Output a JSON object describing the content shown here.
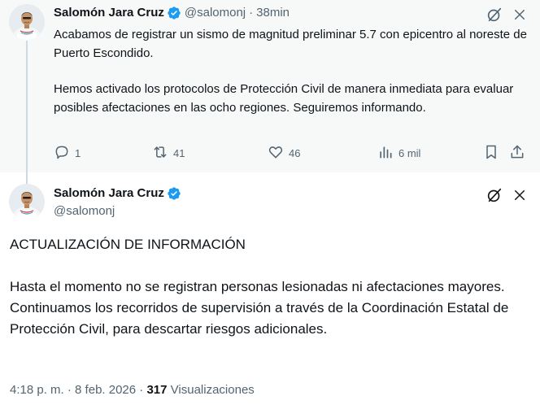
{
  "parent_tweet": {
    "display_name": "Salomón Jara Cruz",
    "handle": "@salomonj",
    "separator": "·",
    "time": "38min",
    "paragraphs": [
      "Acabamos de registrar un sismo de magnitud preliminar 5.7 con epicentro al noreste de Puerto Escondido.",
      "Hemos activado los protocolos de Protección Civil de manera inmediata para evaluar posibles afectaciones en las ocho regiones. Seguiremos informando."
    ],
    "actions": {
      "replies": "1",
      "reposts": "41",
      "likes": "46",
      "views": "6 mil"
    }
  },
  "main_tweet": {
    "display_name": "Salomón Jara Cruz",
    "handle": "@salomonj",
    "paragraphs": [
      "ACTUALIZACIÓN DE INFORMACIÓN",
      "Hasta el momento no se registran personas lesionadas ni afectaciones mayores. Continuamos los recorridos de supervisión a través de la Coordinación Estatal de Protección Civil, para descartar riesgos adicionales."
    ],
    "meta": {
      "time": "4:18 p. m.",
      "separator1": "·",
      "date": "8 feb. 2026",
      "separator2": "·",
      "views_count": "317",
      "views_label": "Visualizaciones"
    }
  },
  "icons": {
    "verified": "verified-badge-icon",
    "grok": "grok-icon",
    "more": "more-icon",
    "reply": "reply-icon",
    "repost": "repost-icon",
    "like": "like-icon",
    "views": "views-icon",
    "bookmark": "bookmark-icon",
    "share": "share-icon"
  },
  "colors": {
    "verified_blue": "#1d9bf0",
    "secondary_text": "#536471",
    "primary_text": "#0f1419",
    "highlight_bg": "#f7f9f9",
    "thread_line": "#cfd9de"
  }
}
